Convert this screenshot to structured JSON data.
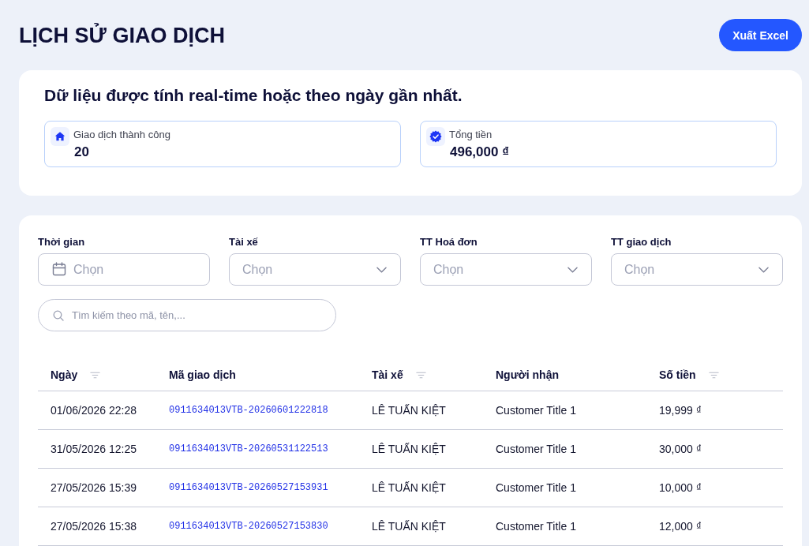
{
  "header": {
    "title": "LỊCH SỬ GIAO DỊCH",
    "export_button": "Xuất Excel"
  },
  "summary": {
    "heading": "Dữ liệu được tính real-time hoặc theo ngày gần nhất.",
    "stats": [
      {
        "kind": "count",
        "label": "Giao dịch thành công",
        "value": "20"
      },
      {
        "kind": "total",
        "label": "Tổng tiền",
        "value": "496,000 ₫"
      }
    ]
  },
  "filters": [
    {
      "kind": "date",
      "label": "Thời gian",
      "placeholder": "Chọn"
    },
    {
      "kind": "select",
      "label": "Tài xế",
      "placeholder": "Chọn"
    },
    {
      "kind": "select",
      "label": "TT Hoá đơn",
      "placeholder": "Chọn"
    },
    {
      "kind": "select",
      "label": "TT giao dịch",
      "placeholder": "Chọn"
    }
  ],
  "search": {
    "placeholder": "Tìm kiếm theo mã, tên,..."
  },
  "table": {
    "columns": [
      {
        "label": "Ngày",
        "filter": true
      },
      {
        "label": "Mã giao dịch",
        "filter": false
      },
      {
        "label": "Tài xế",
        "filter": true
      },
      {
        "label": "Người nhận",
        "filter": false
      },
      {
        "label": "Số tiền",
        "filter": true
      }
    ],
    "rows": [
      {
        "date": "01/06/2026 22:28",
        "transaction_code": "0911634013VTB-20260601222818",
        "driver": "LÊ TUẤN KIỆT",
        "recipient": "Customer Title 1",
        "amount": "19,999 ₫"
      },
      {
        "date": "31/05/2026 12:25",
        "transaction_code": "0911634013VTB-20260531122513",
        "driver": "LÊ TUẤN KIỆT",
        "recipient": "Customer Title 1",
        "amount": "30,000 ₫"
      },
      {
        "date": "27/05/2026 15:39",
        "transaction_code": "0911634013VTB-20260527153931",
        "driver": "LÊ TUẤN KIỆT",
        "recipient": "Customer Title 1",
        "amount": "10,000 ₫"
      },
      {
        "date": "27/05/2026 15:38",
        "transaction_code": "0911634013VTB-20260527153830",
        "driver": "LÊ TUẤN KIỆT",
        "recipient": "Customer Title 1",
        "amount": "12,000 ₫"
      }
    ]
  }
}
